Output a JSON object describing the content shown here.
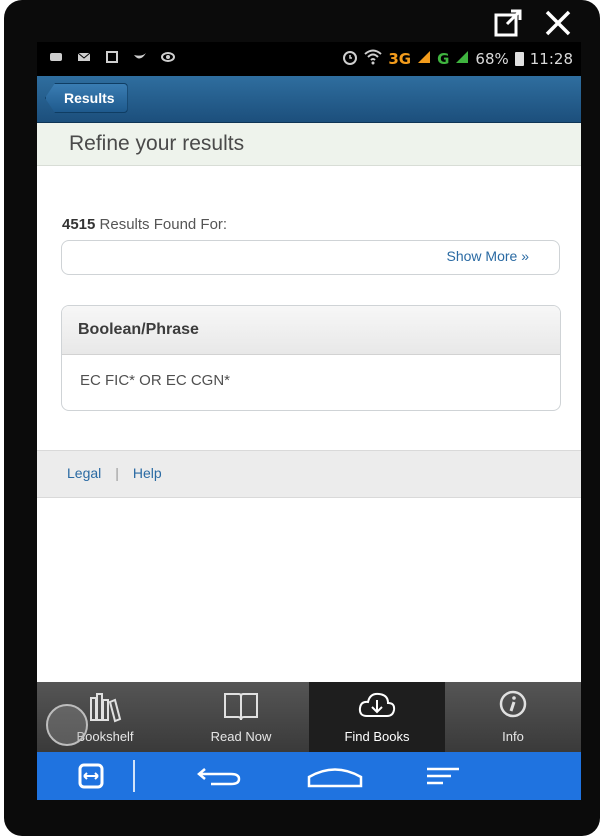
{
  "status_bar": {
    "net_3g": "3G",
    "net_g": "G",
    "battery": "68%",
    "time": "11:28"
  },
  "header": {
    "back_label": "Results"
  },
  "refine": {
    "title": "Refine your results"
  },
  "results": {
    "count": "4515",
    "label": " Results Found For:",
    "show_more": "Show More »"
  },
  "boolean": {
    "heading": "Boolean/Phrase",
    "query": "EC FIC* OR EC CGN*"
  },
  "footer": {
    "legal": "Legal",
    "separator": "|",
    "help": "Help"
  },
  "tabs": [
    {
      "label": "Bookshelf",
      "icon": "bookshelf-icon"
    },
    {
      "label": "Read Now",
      "icon": "open-book-icon"
    },
    {
      "label": "Find Books",
      "icon": "cloud-download-icon",
      "active": true
    },
    {
      "label": "Info",
      "icon": "info-icon"
    }
  ],
  "colors": {
    "nav_bar": "#1f73e0",
    "header": "#1c4f7c",
    "link": "#2a6aa3"
  }
}
